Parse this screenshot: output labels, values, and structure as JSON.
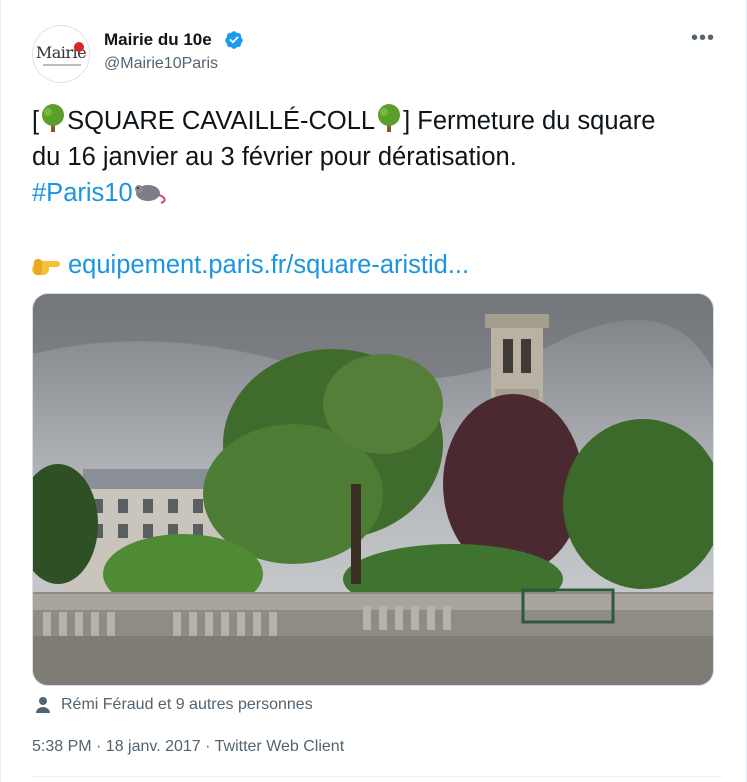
{
  "account": {
    "avatar_text": "Mairie",
    "display_name": "Mairie du 10e",
    "handle": "@Mairie10Paris"
  },
  "tweet": {
    "bracket_open": "[",
    "title": "SQUARE CAVAILLÉ-COLL",
    "bracket_close_text": "] Fermeture du square",
    "line2": "du 16 janvier au 3 février pour dératisation.",
    "hashtag": "#Paris10",
    "url": "equipement.paris.fr/square-aristid..."
  },
  "menu": {
    "more_label": "•••"
  },
  "engagement": {
    "likes_text": "Rémi Féraud et 9 autres personnes"
  },
  "meta": {
    "timestamp": "5:38 PM · 18 janv. 2017 · Twitter Web Client"
  },
  "icons": {
    "verified": "verified-badge-icon",
    "tree": "tree-emoji-icon",
    "rat": "rat-emoji-icon",
    "hand": "pointing-hand-emoji-icon",
    "person": "person-icon"
  },
  "colors": {
    "link": "#1b95e0",
    "verified": "#1d9bf0",
    "secondary": "#536471"
  }
}
